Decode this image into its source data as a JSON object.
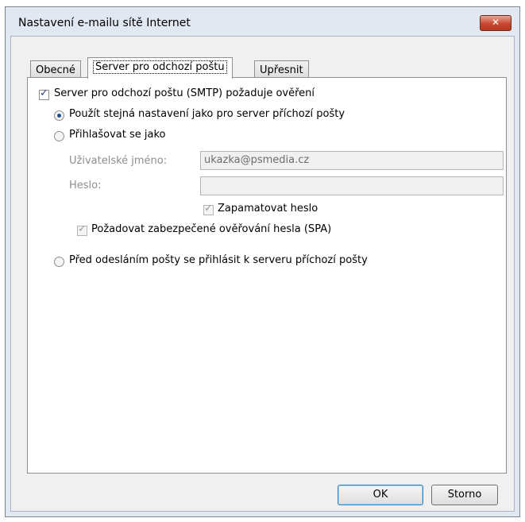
{
  "window": {
    "title": "Nastavení e-mailu sítě Internet",
    "close_label": "✕"
  },
  "tabs": [
    {
      "label": "Obecné"
    },
    {
      "label": "Server pro odchozí poštu"
    },
    {
      "label": "Upřesnit"
    }
  ],
  "smtp_auth": {
    "label": "Server pro odchozí poštu (SMTP) požaduje ověření",
    "checked": true
  },
  "options": {
    "same_settings": {
      "label": "Použít stejná nastavení jako pro server příchozí pošty",
      "selected": true
    },
    "login_as": {
      "label": "Přihlašovat se jako",
      "selected": false
    },
    "login_first": {
      "label": "Před odesláním pošty se přihlásit k serveru příchozí pošty",
      "selected": false
    }
  },
  "credentials": {
    "username_label": "Uživatelské jméno:",
    "username_value": "ukazka@psmedia.cz",
    "password_label": "Heslo:",
    "password_value": "",
    "remember_label": "Zapamatovat heslo",
    "spa_label": "Požadovat zabezpečené ověřování hesla (SPA)"
  },
  "buttons": {
    "ok": "OK",
    "cancel": "Storno"
  }
}
